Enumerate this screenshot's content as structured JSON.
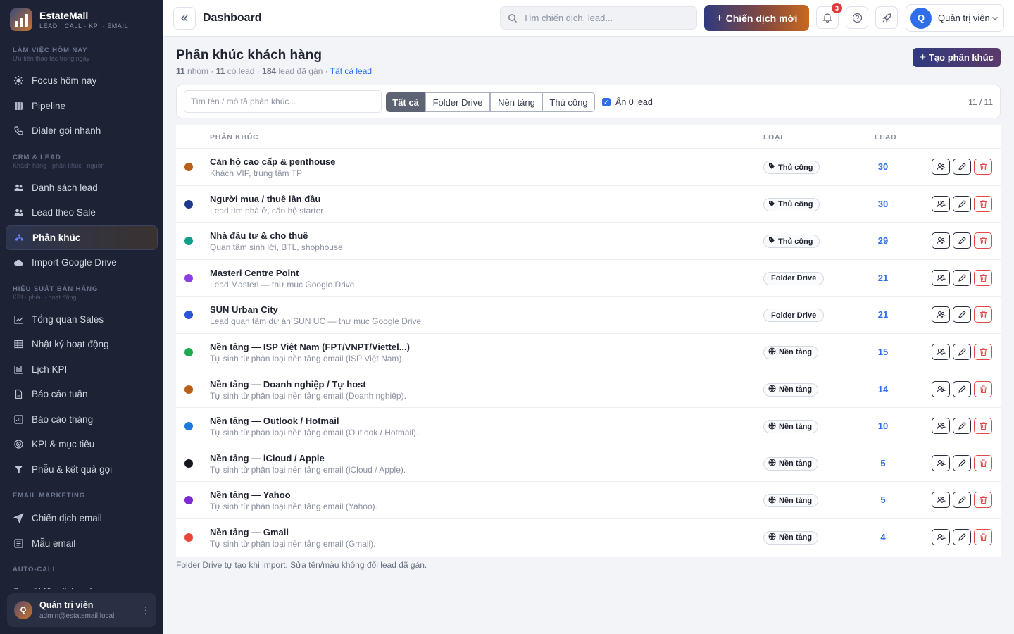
{
  "brand": {
    "name": "EstateMall",
    "tagline": "LEAD · CALL · KPI · EMAIL"
  },
  "sidebar": {
    "sections": [
      {
        "title": "LÀM VIỆC HÔM NAY",
        "subtitle": "Ưu tiên thao tác trong ngày",
        "items": [
          {
            "label": "Focus hôm nay",
            "icon": "sun-icon"
          },
          {
            "label": "Pipeline",
            "icon": "board-icon"
          },
          {
            "label": "Dialer gọi nhanh",
            "icon": "phone-icon"
          }
        ]
      },
      {
        "title": "CRM & LEAD",
        "subtitle": "Khách hàng · phân khúc · nguồn",
        "items": [
          {
            "label": "Danh sách lead",
            "icon": "users-icon"
          },
          {
            "label": "Lead theo Sale",
            "icon": "users-icon"
          },
          {
            "label": "Phân khúc",
            "icon": "segments-icon",
            "active": true
          },
          {
            "label": "Import Google Drive",
            "icon": "cloud-icon"
          }
        ]
      },
      {
        "title": "HIỆU SUẤT BÁN HÀNG",
        "subtitle": "KPI · phễu · hoạt động",
        "items": [
          {
            "label": "Tổng quan Sales",
            "icon": "trend-icon"
          },
          {
            "label": "Nhật ký hoạt động",
            "icon": "table-icon"
          },
          {
            "label": "Lịch KPI",
            "icon": "calendar-icon"
          },
          {
            "label": "Báo cáo tuần",
            "icon": "doc-icon"
          },
          {
            "label": "Báo cáo tháng",
            "icon": "report-icon"
          },
          {
            "label": "KPI & mục tiêu",
            "icon": "target-icon"
          },
          {
            "label": "Phễu & kết quả gọi",
            "icon": "funnel-icon"
          }
        ]
      },
      {
        "title": "EMAIL MARKETING",
        "subtitle": "",
        "items": [
          {
            "label": "Chiến dịch email",
            "icon": "send-icon"
          },
          {
            "label": "Mẫu email",
            "icon": "template-icon"
          }
        ]
      },
      {
        "title": "AUTO-CALL",
        "subtitle": "",
        "items": [
          {
            "label": "Chiến dịch gọi",
            "icon": "phone-icon"
          }
        ]
      }
    ],
    "user": {
      "initial": "Q",
      "name": "Quản trị viên",
      "email": "admin@estatemail.local"
    }
  },
  "topbar": {
    "title": "Dashboard",
    "search_placeholder": "Tìm chiến dịch, lead...",
    "new_campaign_label": "Chiến dịch mới",
    "notification_count": "3",
    "user_initial": "Q",
    "user_name": "Quản trị viên"
  },
  "page": {
    "title": "Phân khúc khách hàng",
    "stats": {
      "groups": "11",
      "groups_label": "nhóm",
      "with_lead": "11",
      "with_lead_label": "có lead",
      "assigned": "184",
      "assigned_label": "lead đã gán",
      "link": "Tất cả lead"
    },
    "create_label": "Tạo phân khúc",
    "filter": {
      "search_placeholder": "Tìm tên / mô tả phân khúc...",
      "segments": [
        "Tất cả",
        "Folder Drive",
        "Nền tảng",
        "Thủ công"
      ],
      "active_segment": 0,
      "hide_zero_label": "Ẩn 0 lead",
      "hide_zero_checked": true,
      "count": "11 / 11"
    },
    "table": {
      "columns": {
        "segment": "PHÂN KHÚC",
        "type": "LOẠI",
        "lead": "LEAD"
      },
      "rows": [
        {
          "name": "Căn hộ cao cấp & penthouse",
          "desc": "Khách VIP, trung tâm TP",
          "color": "#b8601a",
          "type": "Thủ công",
          "type_icon": "tag-icon",
          "lead": "30"
        },
        {
          "name": "Người mua / thuê lần đầu",
          "desc": "Lead tìm nhà ở, căn hộ starter",
          "color": "#1e3a8a",
          "type": "Thủ công",
          "type_icon": "tag-icon",
          "lead": "30"
        },
        {
          "name": "Nhà đầu tư & cho thuê",
          "desc": "Quan tâm sinh lời, BTL, shophouse",
          "color": "#0f9f8a",
          "type": "Thủ công",
          "type_icon": "tag-icon",
          "lead": "29"
        },
        {
          "name": "Masteri Centre Point",
          "desc": "Lead Masteri — thư mục Google Drive",
          "color": "#8b3fe0",
          "type": "Folder Drive",
          "type_icon": "",
          "lead": "21"
        },
        {
          "name": "SUN Urban City",
          "desc": "Lead quan tâm dự án SUN UC — thư mục Google Drive",
          "color": "#2a55d8",
          "type": "Folder Drive",
          "type_icon": "",
          "lead": "21"
        },
        {
          "name": "Nền tảng — ISP Việt Nam (FPT/VNPT/Viettel...)",
          "desc": "Tự sinh từ phân loại nền tảng email (ISP Việt Nam).",
          "color": "#1fa84f",
          "type": "Nền tảng",
          "type_icon": "globe-icon",
          "lead": "15"
        },
        {
          "name": "Nền tảng — Doanh nghiệp / Tự host",
          "desc": "Tự sinh từ phân loại nền tảng email (Doanh nghiệp).",
          "color": "#b8601a",
          "type": "Nền tảng",
          "type_icon": "globe-icon",
          "lead": "14"
        },
        {
          "name": "Nền tảng — Outlook / Hotmail",
          "desc": "Tự sinh từ phân loại nền tảng email (Outlook / Hotmail).",
          "color": "#1f7ae0",
          "type": "Nền tảng",
          "type_icon": "globe-icon",
          "lead": "10"
        },
        {
          "name": "Nền tảng — iCloud / Apple",
          "desc": "Tự sinh từ phân loại nền tảng email (iCloud / Apple).",
          "color": "#15171f",
          "type": "Nền tảng",
          "type_icon": "globe-icon",
          "lead": "5"
        },
        {
          "name": "Nền tảng — Yahoo",
          "desc": "Tự sinh từ phân loại nền tảng email (Yahoo).",
          "color": "#7b2bd0",
          "type": "Nền tảng",
          "type_icon": "globe-icon",
          "lead": "5"
        },
        {
          "name": "Nền tảng — Gmail",
          "desc": "Tự sinh từ phân loại nền tảng email (Gmail).",
          "color": "#e8463a",
          "type": "Nền tảng",
          "type_icon": "globe-icon",
          "lead": "4"
        }
      ]
    },
    "footnote": "Folder Drive tự tạo khi import. Sửa tên/màu không đổi lead đã gán."
  }
}
